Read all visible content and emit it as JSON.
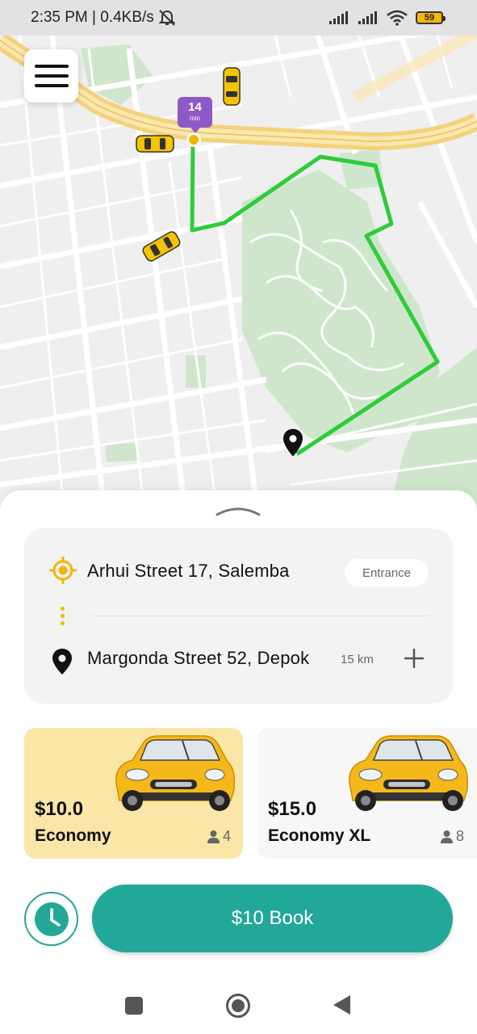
{
  "status_bar": {
    "time_speed": "2:35 PM | 0.4KB/s",
    "battery": "59",
    "icons": [
      "mute-bell-icon",
      "signal-icon",
      "signal-icon",
      "wifi-icon",
      "battery-icon"
    ]
  },
  "map": {
    "eta": {
      "value": "14",
      "unit": "min"
    },
    "route_color": "#2ecc3a",
    "icons": [
      "taxi-icon",
      "destination-pin-icon",
      "menu-icon"
    ]
  },
  "route": {
    "pickup": "Arhui Street 17, Salemba",
    "entrance_label": "Entrance",
    "destination": "Margonda Street 52, Depok",
    "distance": "15 km"
  },
  "car_options": [
    {
      "price": "$10.0",
      "name": "Economy",
      "seats": "4",
      "selected": true
    },
    {
      "price": "$15.0",
      "name": "Economy XL",
      "seats": "8",
      "selected": false
    }
  ],
  "actions": {
    "book_label": "$10 Book"
  },
  "colors": {
    "accent": "#21a898",
    "selected_card": "#fae6a6",
    "pickup_icon": "#f5b400",
    "eta_badge": "#8e59c6",
    "taxi": "#f5c400"
  }
}
